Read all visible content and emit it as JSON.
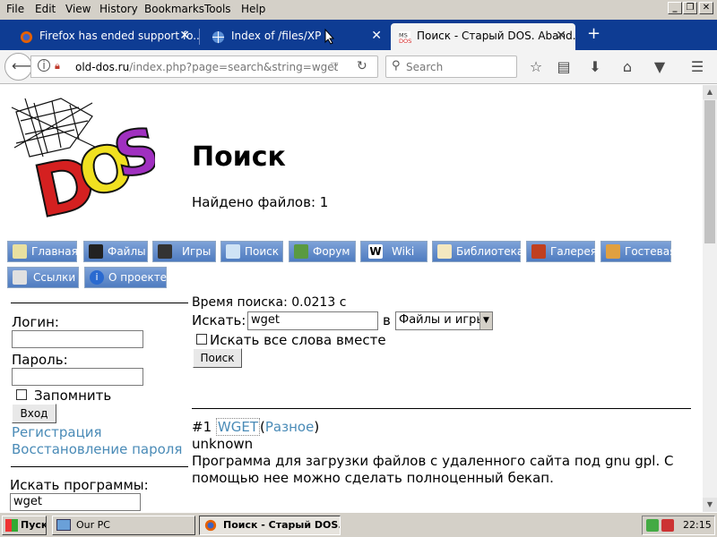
{
  "menubar": {
    "items": [
      "File",
      "Edit",
      "View",
      "History",
      "Bookmarks",
      "Tools",
      "Help"
    ],
    "window_buttons": [
      "_",
      "❐",
      "✕"
    ]
  },
  "tabs": [
    {
      "label": "Firefox has ended support fo..."
    },
    {
      "label": "Index of /files/XP"
    },
    {
      "label": "Поиск - Старый DOS. Aband..."
    }
  ],
  "navbar": {
    "url_host": "old-dos.ru",
    "url_path": "/index.php?page=search&string=wget",
    "search_placeholder": "Search"
  },
  "page": {
    "title": "Поиск",
    "found_text": "Найдено файлов: 1",
    "nav_buttons": [
      "Главная",
      "Файлы",
      "Игры",
      "Поиск",
      "Форум",
      "Wiki",
      "Библиотека",
      "Галерея",
      "Гостевая",
      "Ссылки",
      "О проекте"
    ],
    "search_time": "Время поиска: 0.0213 с",
    "search_label": "Искать:",
    "search_value": "wget",
    "in_label": "в",
    "scope_value": "Файлы и игры",
    "all_words_label": "Искать все слова вместе",
    "search_button": "Поиск",
    "result": {
      "number": "#1",
      "name": "WGET",
      "open_paren": "(",
      "category": "Разное",
      "close_paren": ")",
      "author": "unknown",
      "description_line1": "Программа для загрузки файлов с удаленного сайта под gnu gpl. С",
      "description_line2": "помощью нее можно сделать полноценный бекап."
    }
  },
  "sidebar": {
    "login_label": "Логин:",
    "password_label": "Пароль:",
    "remember_label": "Запомнить",
    "login_button": "Вход",
    "register_link": "Регистрация",
    "restore_link": "Восстановление пароля",
    "search_programs_label": "Искать программы:",
    "search_programs_value": "wget"
  },
  "taskbar": {
    "start_label": "Пуск",
    "items": [
      "Our PC",
      "Поиск - Старый DOS. ..."
    ],
    "clock": "22:15"
  },
  "colors": {
    "tabbar": "#0e3c93",
    "link": "#4a8bb7",
    "nav_button": "#4f7cc0"
  }
}
